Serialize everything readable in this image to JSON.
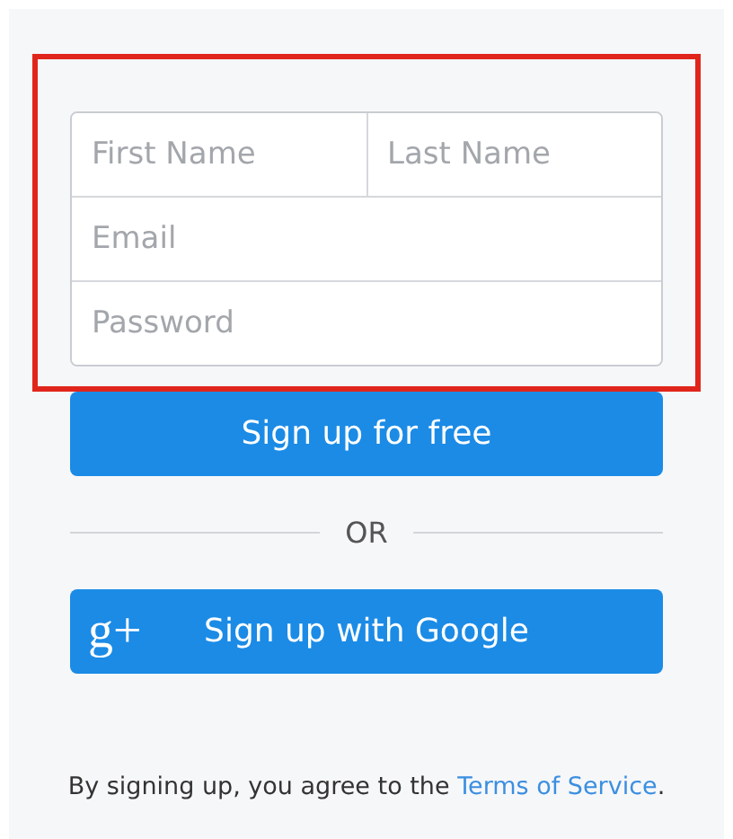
{
  "highlight": {
    "shown": true
  },
  "fields": [
    {
      "placeholder": "First Name"
    },
    {
      "placeholder": "Last Name"
    },
    {
      "placeholder": "Email"
    },
    {
      "placeholder": "Password"
    }
  ],
  "signup_button": {
    "label": "Sign up for free"
  },
  "divider": {
    "label": "OR"
  },
  "google_button": {
    "icon": "g+",
    "label": "Sign up with Google"
  },
  "terms": {
    "before": "By signing up, you agree to the ",
    "link": "Terms of Service",
    "after": "."
  }
}
